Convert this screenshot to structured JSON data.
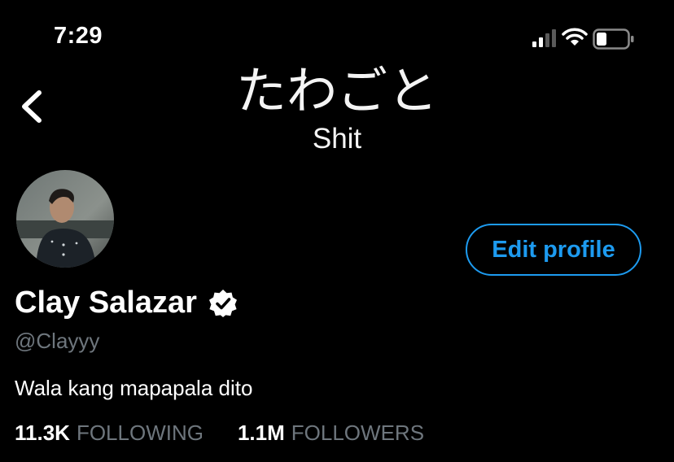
{
  "status_bar": {
    "time": "7:29",
    "icons": [
      "signal-icon",
      "wifi-icon",
      "battery-icon"
    ]
  },
  "header": {
    "back_icon": "chevron-left-icon",
    "banner_title": "たわごと",
    "banner_subtitle": "Shit"
  },
  "profile": {
    "display_name": "Clay Salazar",
    "verified": true,
    "verified_icon": "verified-badge-icon",
    "handle": "@Clayyy",
    "bio": "Wala kang mapapala dito",
    "edit_button_label": "Edit profile",
    "following_count": "11.3K",
    "following_label": "FOLLOWING",
    "followers_count": "1.1M",
    "followers_label": "FOLLOWERS"
  },
  "colors": {
    "background": "#000000",
    "accent": "#1d9bf0",
    "secondary_text": "#6e767d",
    "primary_text": "#ffffff"
  }
}
